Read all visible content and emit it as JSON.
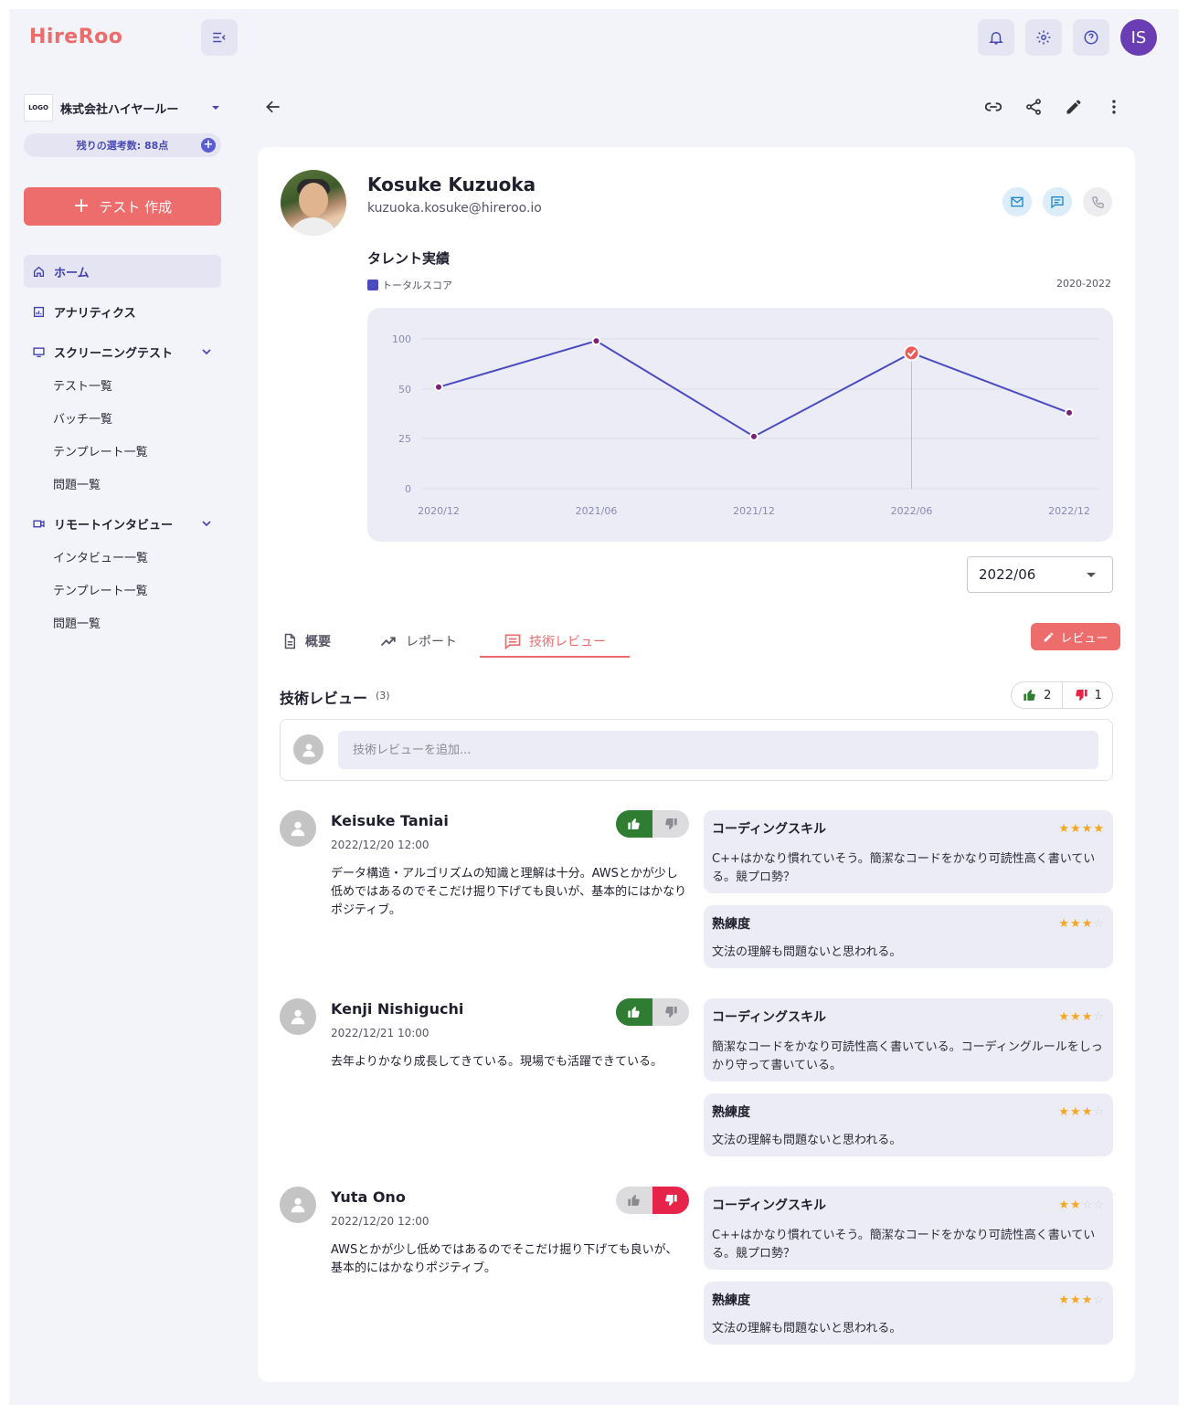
{
  "brand": "HireRoo",
  "company": {
    "logo_text": "LOGO",
    "name": "株式会社ハイヤールー"
  },
  "quota": "残りの選考数: 88点",
  "create_button": "テスト 作成",
  "user_initials": "IS",
  "sidebar": {
    "home": "ホーム",
    "analytics": "アナリティクス",
    "screening": {
      "label": "スクリーニングテスト",
      "items": [
        "テスト一覧",
        "バッチ一覧",
        "テンプレート一覧",
        "問題一覧"
      ]
    },
    "interview": {
      "label": "リモートインタビュー",
      "items": [
        "インタビュー一覧",
        "テンプレート一覧",
        "問題一覧"
      ]
    }
  },
  "candidate": {
    "name": "Kosuke Kuzuoka",
    "email": "kuzuoka.kosuke@hireroo.io"
  },
  "talent": {
    "title": "タレント実績",
    "legend": "トータルスコア",
    "range": "2020-2022"
  },
  "chart_data": {
    "type": "line",
    "title": "",
    "x": [
      "2020/12",
      "2021/06",
      "2021/12",
      "2022/06",
      "2022/12"
    ],
    "yticks": [
      "0",
      "25",
      "50",
      "100"
    ],
    "series": [
      {
        "name": "トータルスコア",
        "values": [
          52,
          98,
          26,
          86,
          38
        ]
      }
    ],
    "highlighted_x": "2022/06",
    "color": "#4b4bc0",
    "highlight_color": "#ec5b5b",
    "grid": true
  },
  "period_select": "2022/06",
  "tabs": [
    "概要",
    "レポート",
    "技術レビュー"
  ],
  "review_button": "レビュー",
  "reviews_section": {
    "title": "技術レビュー",
    "count": "(3)",
    "likes": "2",
    "dislikes": "1",
    "placeholder": "技術レビューを追加..."
  },
  "reviews": [
    {
      "name": "Keisuke Taniai",
      "date": "2022/12/20 12:00",
      "text": "データ構造・アルゴリズムの知識と理解は十分。AWSとかが少し低めではあるのでそこだけ掘り下げても良いが、基本的にはかなりポジティブ。",
      "vote": "up",
      "skills": [
        {
          "label": "コーディングスキル",
          "rating": 4,
          "comment": "C++はかなり慣れていそう。簡潔なコードをかなり可読性高く書いている。競プロ勢？"
        },
        {
          "label": "熟練度",
          "rating": 3,
          "comment": "文法の理解も問題ないと思われる。"
        }
      ]
    },
    {
      "name": "Kenji Nishiguchi",
      "date": "2022/12/21 10:00",
      "text": "去年よりかなり成長してきている。現場でも活躍できている。",
      "vote": "up",
      "skills": [
        {
          "label": "コーディングスキル",
          "rating": 3,
          "comment": "簡潔なコードをかなり可読性高く書いている。コーディングルールをしっかり守って書いている。"
        },
        {
          "label": "熟練度",
          "rating": 3,
          "comment": "文法の理解も問題ないと思われる。"
        }
      ]
    },
    {
      "name": "Yuta Ono",
      "date": "2022/12/20 12:00",
      "text": "AWSとかが少し低めではあるのでそこだけ掘り下げても良いが、基本的にはかなりポジティブ。",
      "vote": "down",
      "skills": [
        {
          "label": "コーディングスキル",
          "rating": 2,
          "comment": "C++はかなり慣れていそう。簡潔なコードをかなり可読性高く書いている。競プロ勢？"
        },
        {
          "label": "熟練度",
          "rating": 3,
          "comment": "文法の理解も問題ないと思われる。"
        }
      ]
    }
  ]
}
